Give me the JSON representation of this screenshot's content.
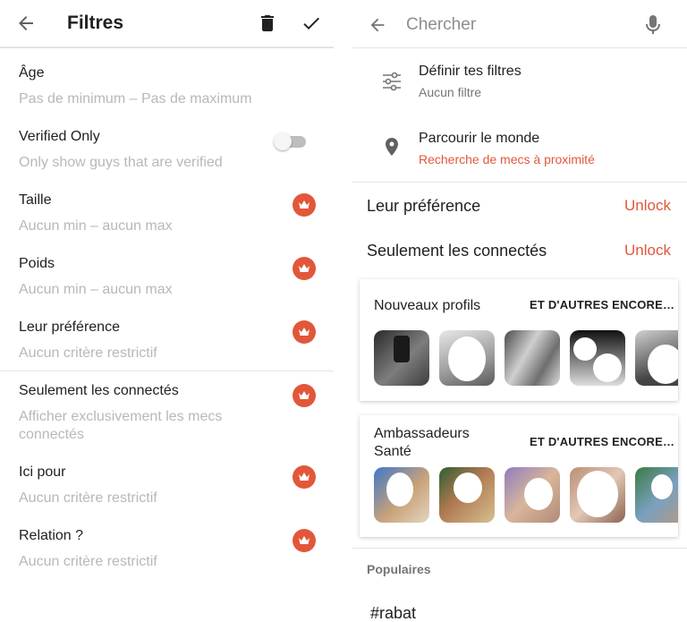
{
  "colors": {
    "accent": "#e2573a",
    "muted_text": "#b8b8b8",
    "divider": "#e4e4e4"
  },
  "filters": {
    "title": "Filtres",
    "icons": {
      "back": "arrow-back-icon",
      "delete": "trash-icon",
      "confirm": "check-icon"
    },
    "rows": [
      {
        "label": "Âge",
        "value": "Pas de minimum – Pas de maximum"
      },
      {
        "label": "Verified Only",
        "value": "Only show guys that are verified",
        "toggle": false
      },
      {
        "label": "Taille",
        "value": "Aucun min – aucun max",
        "premium": true
      },
      {
        "label": "Poids",
        "value": "Aucun min – aucun max",
        "premium": true
      },
      {
        "label": "Leur préférence",
        "value": "Aucun critère restrictif",
        "premium": true
      },
      {
        "label": "Seulement les connectés",
        "value": "Afficher exclusivement les mecs connectés",
        "premium": true
      },
      {
        "label": "Ici pour",
        "value": "Aucun critère restrictif",
        "premium": true
      },
      {
        "label": "Relation ?",
        "value": "Aucun critère restrictif",
        "premium": true
      }
    ]
  },
  "search": {
    "placeholder": "Chercher",
    "icons": {
      "back": "arrow-back-icon",
      "voice": "microphone-icon"
    },
    "options": [
      {
        "title": "Définir tes filtres",
        "subtitle": "Aucun filtre",
        "icon": "sliders-icon"
      },
      {
        "title": "Parcourir le monde",
        "subtitle": "Recherche de mecs à proximité",
        "icon": "location-pin-icon"
      }
    ],
    "premium_rows": [
      {
        "label": "Leur préférence",
        "action": "Unlock"
      },
      {
        "label": "Seulement les connectés",
        "action": "Unlock"
      }
    ],
    "cards": [
      {
        "title": "Nouveaux profils",
        "more": "ET D'AUTRES ENCORE…",
        "thumb_count": 5
      },
      {
        "title": "Ambassadeurs Santé",
        "more": "ET D'AUTRES ENCORE…",
        "thumb_count": 5
      }
    ],
    "section_title": "Populaires",
    "tags": [
      "#rabat"
    ]
  }
}
